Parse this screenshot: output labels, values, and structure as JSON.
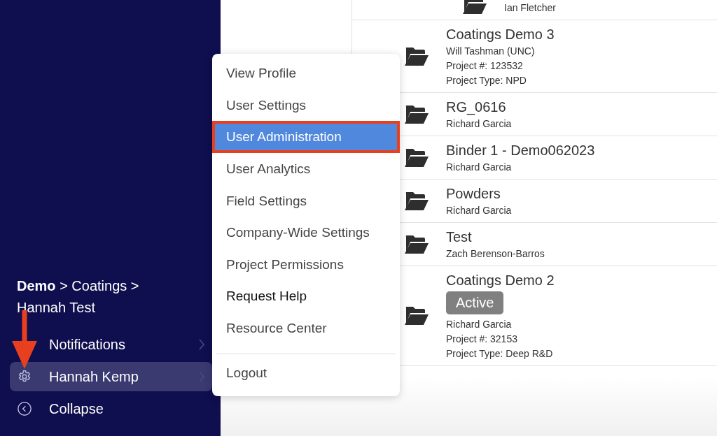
{
  "sidebar": {
    "breadcrumb": "**Demo** > Coatings > Hannah Test",
    "nav_items": [
      {
        "label": "Notifications",
        "kind": "submenu",
        "selected": false
      },
      {
        "label": "Hannah Kemp",
        "kind": "submenu",
        "selected": true
      },
      {
        "label": "Collapse",
        "kind": "action",
        "selected": false
      }
    ]
  },
  "projects": [
    {
      "kind": "nested",
      "lines": [
        "Ian Fletcher"
      ]
    },
    {
      "kind": "folder",
      "title": "Coatings Demo 3",
      "lines": [
        "Will Tashman (UNC)",
        "Project #: 123532",
        "Project Type: NPD"
      ]
    },
    {
      "kind": "folder",
      "title": "RG_0616",
      "lines": [
        "Richard Garcia"
      ]
    },
    {
      "kind": "folder",
      "title": "Binder 1 - Demo062023",
      "lines": [
        "Richard Garcia"
      ]
    },
    {
      "kind": "folder",
      "title": "Powders",
      "lines": [
        "Richard Garcia"
      ]
    },
    {
      "kind": "folder",
      "title": "Test",
      "lines": [
        "Zach Berenson-Barros"
      ]
    },
    {
      "kind": "folder",
      "title": "Coatings Demo 2",
      "status": "Active",
      "lines": [
        "Richard Garcia",
        "Project #: 32153",
        "Project Type: Deep R&D"
      ]
    }
  ],
  "user_menu": {
    "items": [
      {
        "label": "View Profile",
        "kind": "item",
        "selected": false
      },
      {
        "label": "User Settings",
        "kind": "item",
        "selected": false
      },
      {
        "label": "User Administration",
        "kind": "item",
        "selected": true
      },
      {
        "label": "User Analytics",
        "kind": "item",
        "selected": false
      },
      {
        "label": "Field Settings",
        "kind": "item",
        "selected": false
      },
      {
        "label": "Company-Wide Settings",
        "kind": "item",
        "selected": false
      },
      {
        "label": "Project Permissions",
        "kind": "item",
        "selected": false
      },
      {
        "label": "Request Help",
        "kind": "strong",
        "selected": false
      },
      {
        "label": "Resource Center",
        "kind": "item",
        "selected": false
      },
      {
        "label": "Logout",
        "kind": "separated",
        "selected": false
      }
    ]
  }
}
